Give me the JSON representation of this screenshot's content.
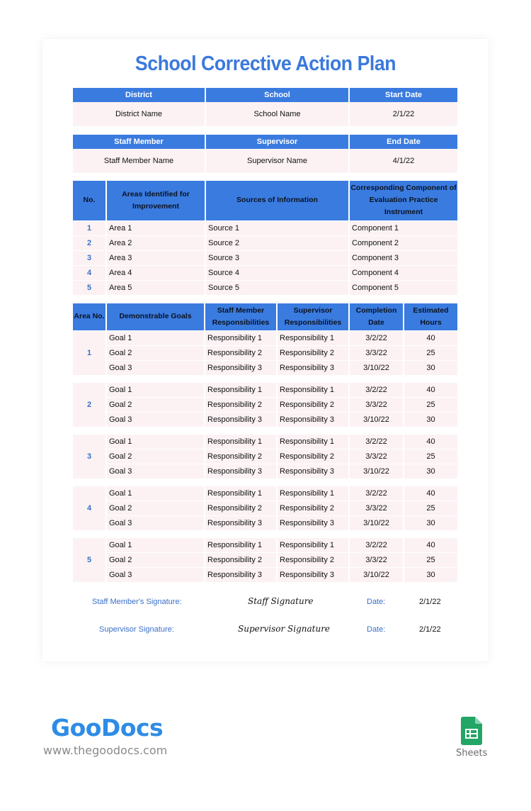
{
  "title": "School Corrective Action Plan",
  "info_table_1": {
    "headers": [
      "District",
      "School",
      "Start Date"
    ],
    "values": [
      "District Name",
      "School Name",
      "2/1/22"
    ]
  },
  "info_table_2": {
    "headers": [
      "Staff Member",
      "Supervisor",
      "End Date"
    ],
    "values": [
      "Staff Member Name",
      "Supervisor Name",
      "4/1/22"
    ]
  },
  "areas_table": {
    "headers": [
      "No.",
      "Areas Identified for Improvement",
      "Sources of Information",
      "Corresponding Component of Evaluation Practice Instrument"
    ],
    "rows": [
      [
        "1",
        "Area 1",
        "Source 1",
        "Component 1"
      ],
      [
        "2",
        "Area 2",
        "Source 2",
        "Component 2"
      ],
      [
        "3",
        "Area 3",
        "Source 3",
        "Component 3"
      ],
      [
        "4",
        "Area 4",
        "Source 4",
        "Component 4"
      ],
      [
        "5",
        "Area 5",
        "Source 5",
        "Component 5"
      ]
    ]
  },
  "goals_table": {
    "headers": [
      "Area No.",
      "Demonstrable Goals",
      "Staff Member Responsibilities",
      "Supervisor Responsibilities",
      "Completion Date",
      "Estimated Hours"
    ],
    "groups": [
      {
        "area": "1",
        "rows": [
          [
            "Goal 1",
            "Responsibility 1",
            "Responsibility 1",
            "3/2/22",
            "40"
          ],
          [
            "Goal 2",
            "Responsibility 2",
            "Responsibility 2",
            "3/3/22",
            "25"
          ],
          [
            "Goal 3",
            "Responsibility 3",
            "Responsibility 3",
            "3/10/22",
            "30"
          ]
        ]
      },
      {
        "area": "2",
        "rows": [
          [
            "Goal 1",
            "Responsibility 1",
            "Responsibility 1",
            "3/2/22",
            "40"
          ],
          [
            "Goal 2",
            "Responsibility 2",
            "Responsibility 2",
            "3/3/22",
            "25"
          ],
          [
            "Goal 3",
            "Responsibility 3",
            "Responsibility 3",
            "3/10/22",
            "30"
          ]
        ]
      },
      {
        "area": "3",
        "rows": [
          [
            "Goal 1",
            "Responsibility 1",
            "Responsibility 1",
            "3/2/22",
            "40"
          ],
          [
            "Goal 2",
            "Responsibility 2",
            "Responsibility 2",
            "3/3/22",
            "25"
          ],
          [
            "Goal 3",
            "Responsibility 3",
            "Responsibility 3",
            "3/10/22",
            "30"
          ]
        ]
      },
      {
        "area": "4",
        "rows": [
          [
            "Goal 1",
            "Responsibility 1",
            "Responsibility 1",
            "3/2/22",
            "40"
          ],
          [
            "Goal 2",
            "Responsibility 2",
            "Responsibility 2",
            "3/3/22",
            "25"
          ],
          [
            "Goal 3",
            "Responsibility 3",
            "Responsibility 3",
            "3/10/22",
            "30"
          ]
        ]
      },
      {
        "area": "5",
        "rows": [
          [
            "Goal 1",
            "Responsibility 1",
            "Responsibility 1",
            "3/2/22",
            "40"
          ],
          [
            "Goal 2",
            "Responsibility 2",
            "Responsibility 2",
            "3/3/22",
            "25"
          ],
          [
            "Goal 3",
            "Responsibility 3",
            "Responsibility 3",
            "3/10/22",
            "30"
          ]
        ]
      }
    ]
  },
  "signatures": {
    "staff": {
      "label": "Staff Member's Signature:",
      "signature": "Staff Signature",
      "date_label": "Date:",
      "date": "2/1/22"
    },
    "supervisor": {
      "label": "Supervisor Signature:",
      "signature": "Supervisor Signature",
      "date_label": "Date:",
      "date": "2/1/22"
    }
  },
  "branding": {
    "logo_text": "GooDocs",
    "url": "www.thegoodocs.com",
    "app_label": "Sheets",
    "colors": {
      "accent": "#3a7be0",
      "title": "#3b79dd",
      "row_bg": "#fcf2f4",
      "logo": "#2e8ce6",
      "sheets_green": "#23a566"
    }
  }
}
